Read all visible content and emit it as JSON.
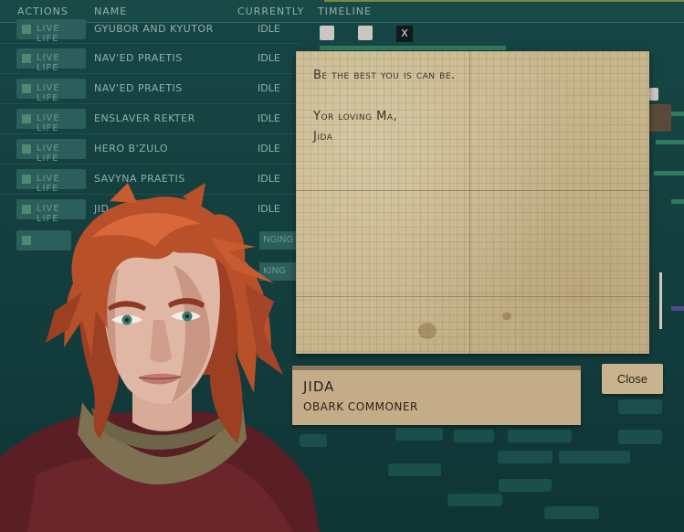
{
  "header": {
    "actions": "ACTIONS",
    "name": "NAME",
    "currently": "CURRENTLY",
    "timeline": "TIMELINE"
  },
  "rows": [
    {
      "action": "LIVE LIFE",
      "name": "GYUBOR AND KYUTOR",
      "status": "IDLE"
    },
    {
      "action": "LIVE LIFE",
      "name": "NAV'ED PRAETIS",
      "status": "IDLE"
    },
    {
      "action": "LIVE LIFE",
      "name": "NAV'ED PRAETIS",
      "status": "IDLE"
    },
    {
      "action": "LIVE LIFE",
      "name": "ENSLAVER REKTER",
      "status": "IDLE"
    },
    {
      "action": "LIVE LIFE",
      "name": "HERO B'ZULO",
      "status": "IDLE"
    },
    {
      "action": "LIVE LIFE",
      "name": "SAVYNA PRAETIS",
      "status": "IDLE"
    },
    {
      "action": "LIVE LIFE",
      "name": "JID",
      "status": "IDLE"
    }
  ],
  "fragments": {
    "singing": "NGING",
    "king": "KING"
  },
  "timeline": {
    "close_x": "X"
  },
  "letter": {
    "line1": "Be the best you is can be.",
    "line2": "Yor loving Ma,",
    "line3": "Jida"
  },
  "character": {
    "name": "JIDA",
    "description": "OBARK COMMONER"
  },
  "close_button": "Close",
  "colors": {
    "background": "#133d3d",
    "paper": "#c7b58c",
    "plate": "#c4ac88",
    "hair": "#b8502a"
  }
}
